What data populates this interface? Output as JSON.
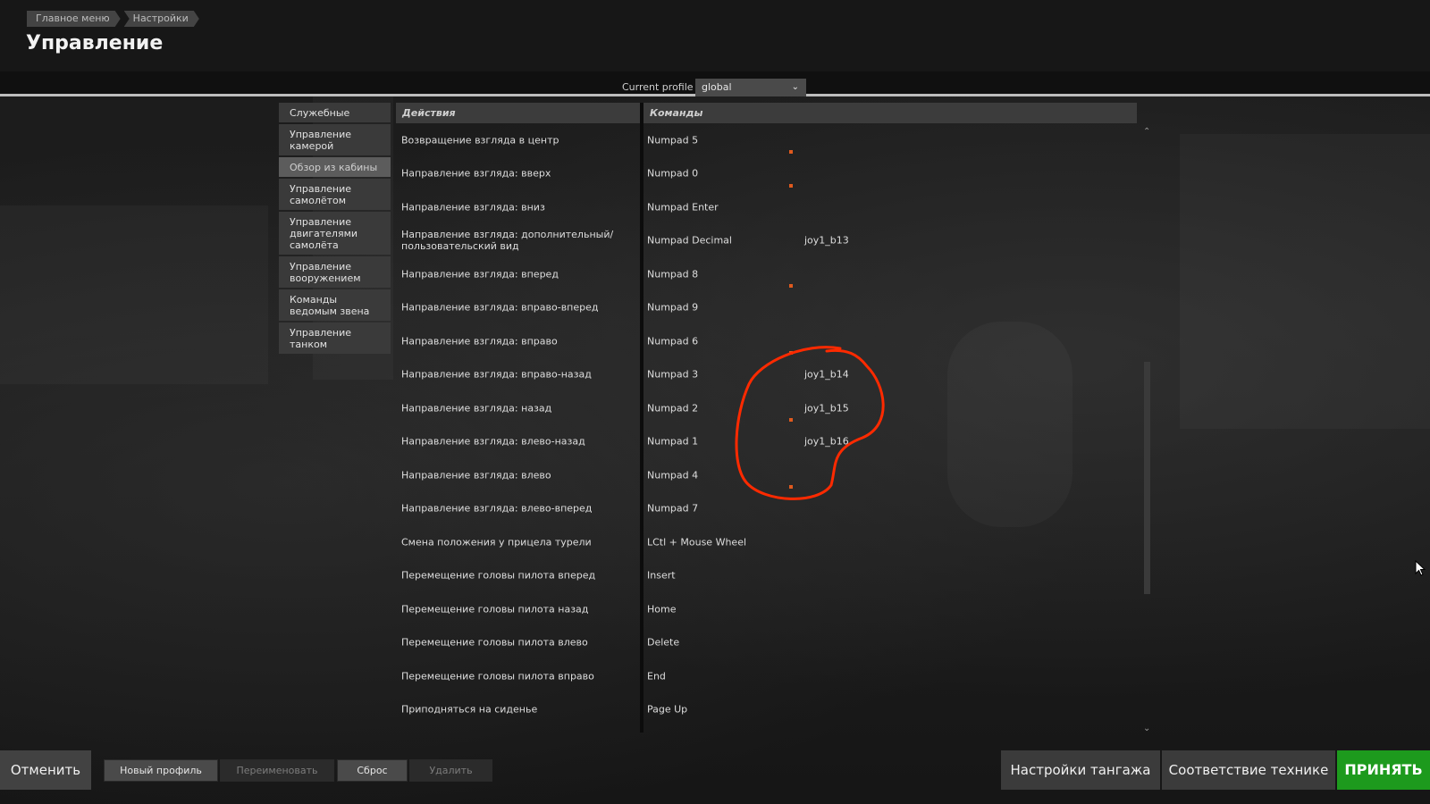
{
  "breadcrumb": [
    "Главное меню",
    "Настройки"
  ],
  "page_title": "Управление",
  "profile": {
    "label": "Current profile",
    "value": "global"
  },
  "sidebar": [
    {
      "label": "Служебные"
    },
    {
      "label": "Управление камерой"
    },
    {
      "label": "Обзор из кабины",
      "active": true
    },
    {
      "label": "Управление самолётом"
    },
    {
      "label": "Управление двигателями самолёта"
    },
    {
      "label": "Управление вооружением"
    },
    {
      "label": "Команды ведомым звена"
    },
    {
      "label": "Управление танком"
    }
  ],
  "table": {
    "col_actions": "Действия",
    "col_commands": "Команды",
    "rows": [
      {
        "action": "Возвращение взгляда в центр",
        "cmd1": "Numpad 5",
        "cmd2": "",
        "mark": true
      },
      {
        "action": "Направление взгляда: вверх",
        "cmd1": "Numpad 0",
        "cmd2": "",
        "mark": true
      },
      {
        "action": "Направление взгляда: вниз",
        "cmd1": "Numpad Enter",
        "cmd2": "",
        "mark": false
      },
      {
        "action": "Направление взгляда: дополнительный/пользовательский вид",
        "cmd1": "Numpad Decimal",
        "cmd2": "joy1_b13",
        "mark": false
      },
      {
        "action": "Направление взгляда: вперед",
        "cmd1": "Numpad 8",
        "cmd2": "",
        "mark": true
      },
      {
        "action": "Направление взгляда: вправо-вперед",
        "cmd1": "Numpad 9",
        "cmd2": "",
        "mark": false
      },
      {
        "action": "Направление взгляда: вправо",
        "cmd1": "Numpad 6",
        "cmd2": "",
        "mark": true
      },
      {
        "action": "Направление взгляда: вправо-назад",
        "cmd1": "Numpad 3",
        "cmd2": "joy1_b14",
        "mark": false
      },
      {
        "action": "Направление взгляда: назад",
        "cmd1": "Numpad 2",
        "cmd2": "joy1_b15",
        "mark": true
      },
      {
        "action": "Направление взгляда: влево-назад",
        "cmd1": "Numpad 1",
        "cmd2": "joy1_b16",
        "mark": false
      },
      {
        "action": "Направление взгляда: влево",
        "cmd1": "Numpad 4",
        "cmd2": "",
        "mark": true
      },
      {
        "action": "Направление взгляда: влево-вперед",
        "cmd1": "Numpad 7",
        "cmd2": "",
        "mark": false
      },
      {
        "action": "Смена положения у прицела турели",
        "cmd1": "LCtl + Mouse Wheel",
        "cmd2": "",
        "mark": false
      },
      {
        "action": "Перемещение головы пилота вперед",
        "cmd1": "Insert",
        "cmd2": "",
        "mark": false
      },
      {
        "action": "Перемещение головы пилота назад",
        "cmd1": "Home",
        "cmd2": "",
        "mark": false
      },
      {
        "action": "Перемещение головы пилота влево",
        "cmd1": "Delete",
        "cmd2": "",
        "mark": false
      },
      {
        "action": "Перемещение головы пилота вправо",
        "cmd1": "End",
        "cmd2": "",
        "mark": false
      },
      {
        "action": "Приподняться на сиденье",
        "cmd1": "Page Up",
        "cmd2": "",
        "mark": false
      }
    ]
  },
  "buttons": {
    "cancel": "Отменить",
    "new_profile": "Новый профиль",
    "rename": "Переименовать",
    "reset": "Сброс",
    "delete": "Удалить",
    "pitch_settings": "Настройки тангажа",
    "aircraft_mapping": "Соответствие технике",
    "accept": "ПРИНЯТЬ"
  },
  "colors": {
    "accept": "#1d9a1d",
    "annotation": "#ff2a00",
    "mark": "#e05a1e"
  }
}
